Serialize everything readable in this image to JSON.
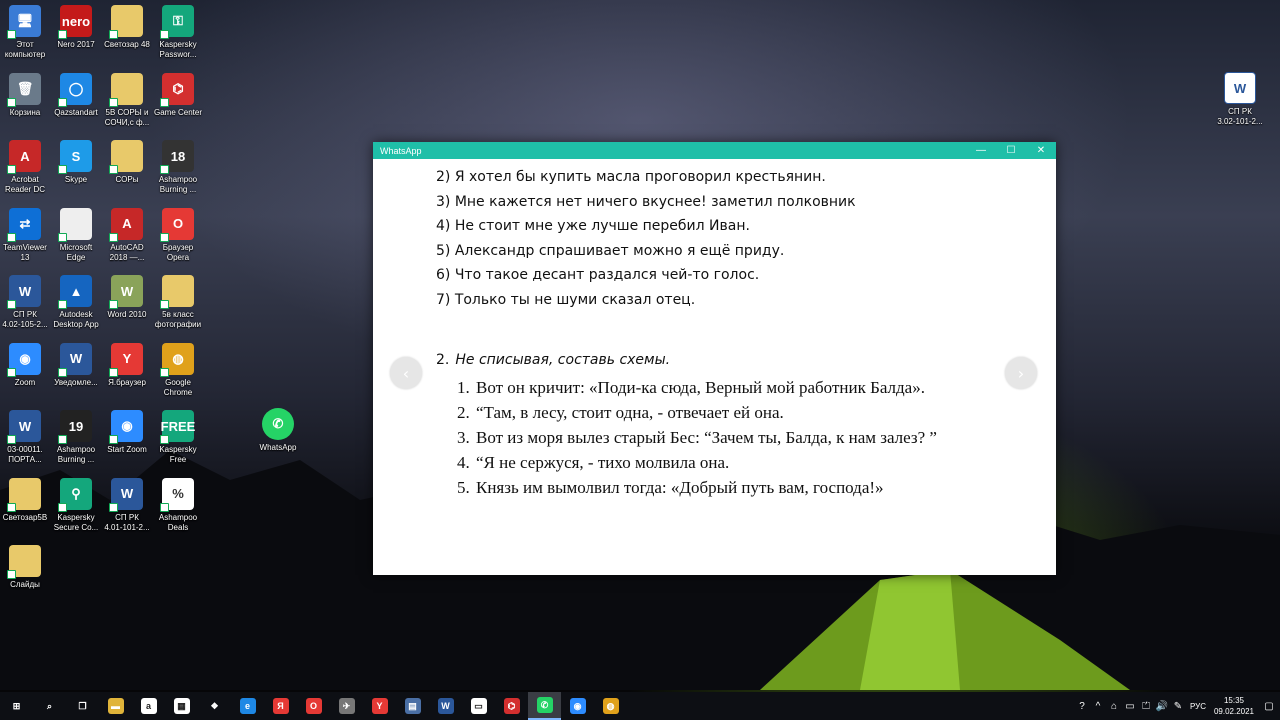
{
  "desktop": {
    "icons": [
      {
        "label": "Этот\nкомпьютер",
        "glyph": "🖥",
        "color": "#3a7bd5"
      },
      {
        "label": "Nero 2017",
        "glyph": "nero",
        "color": "#c41a1a"
      },
      {
        "label": "Светозар 48",
        "glyph": "",
        "color": "#e8c96a"
      },
      {
        "label": "Kaspersky\nPasswor...",
        "glyph": "⚿",
        "color": "#14a77c"
      },
      {
        "label": "Корзина",
        "glyph": "🗑",
        "color": "#6a7a8a"
      },
      {
        "label": "Qazstandart",
        "glyph": "◯",
        "color": "#1e88e5"
      },
      {
        "label": "5В СОРЫ и\nСОЧИ,с ф...",
        "glyph": "",
        "color": "#e8c96a"
      },
      {
        "label": "Game Center",
        "glyph": "⌬",
        "color": "#d32f2f"
      },
      {
        "label": "Acrobat\nReader DC",
        "glyph": "A",
        "color": "#c62828"
      },
      {
        "label": "Skype",
        "glyph": "S",
        "color": "#1e9be8"
      },
      {
        "label": "СОРы",
        "glyph": "",
        "color": "#e8c96a"
      },
      {
        "label": "Ashampoo\nBurning ...",
        "glyph": "18",
        "color": "#333"
      },
      {
        "label": "TeamViewer\n13",
        "glyph": "⇄",
        "color": "#0e6fd6"
      },
      {
        "label": "Microsoft\nEdge",
        "glyph": "",
        "color": "#eeeeee"
      },
      {
        "label": "AutoCAD\n2018 —...",
        "glyph": "A",
        "color": "#c62828"
      },
      {
        "label": "Браузер\nOpera",
        "glyph": "O",
        "color": "#e53935"
      },
      {
        "label": "СП РК\n4.02-105-2...",
        "glyph": "W",
        "color": "#2b579a"
      },
      {
        "label": "Autodesk\nDesktop App",
        "glyph": "▲",
        "color": "#1565c0"
      },
      {
        "label": "Word 2010",
        "glyph": "W",
        "color": "#8aa35a"
      },
      {
        "label": "5в класс\nфотографии",
        "glyph": "",
        "color": "#e8c96a"
      },
      {
        "label": "Zoom",
        "glyph": "◉",
        "color": "#2d8cff"
      },
      {
        "label": "Уведомле...",
        "glyph": "W",
        "color": "#2b579a"
      },
      {
        "label": "Я.браузер",
        "glyph": "Y",
        "color": "#e53935"
      },
      {
        "label": "Google\nChrome",
        "glyph": "◍",
        "color": "#e0a11b"
      },
      {
        "label": "03-00011.\nПОРТА...",
        "glyph": "W",
        "color": "#2b579a"
      },
      {
        "label": "Ashampoo\nBurning ...",
        "glyph": "19",
        "color": "#222"
      },
      {
        "label": "Start Zoom",
        "glyph": "◉",
        "color": "#2d8cff"
      },
      {
        "label": "Kaspersky\nFree",
        "glyph": "FREE",
        "color": "#14a77c"
      },
      {
        "label": "Светозар5В",
        "glyph": "",
        "color": "#e8c96a"
      },
      {
        "label": "Kaspersky\nSecure Co...",
        "glyph": "⚲",
        "color": "#14a77c"
      },
      {
        "label": "СП РК\n4.01-101-2...",
        "glyph": "W",
        "color": "#2b579a"
      },
      {
        "label": "Ashampoo\nDeals",
        "glyph": "%",
        "color": "#ffffff"
      },
      {
        "label": "Слайды",
        "glyph": "",
        "color": "#e8c96a"
      }
    ],
    "whatsapp_icon": {
      "label": "WhatsApp",
      "glyph": "✆",
      "color": "#25d366"
    },
    "right_icon": {
      "label": "СП РК\n3.02-101-2...",
      "glyph": "W",
      "color": "#2b579a"
    }
  },
  "window": {
    "title": "WhatsApp",
    "controls": {
      "minimize": "—",
      "maximize": "☐",
      "close": "✕"
    },
    "lines1": [
      "2) Я хотел бы купить масла проговорил крестьянин.",
      "3) Мне кажется нет ничего вкуснее! заметил полковник",
      "4) Не стоит мне уже лучше перебил Иван.",
      "5) Александр спрашивает можно я ещё приду.",
      "6) Что такое десант раздался чей-то голос.",
      "7) Только ты не шуми сказал отец."
    ],
    "task2": {
      "number": "2.",
      "text": "Не списывая, составь схемы."
    },
    "lines2": [
      {
        "n": "1.",
        "text": "Вот он кричит: «Поди-ка сюда, Верный мой работник Балда»."
      },
      {
        "n": "2.",
        "text": "“Там, в лесу, стоит одна, - отвечает ей она."
      },
      {
        "n": "3.",
        "text": "Вот из моря вылез старый Бес: “Зачем ты, Балда, к нам залез? ”"
      },
      {
        "n": "4.",
        "text": "“Я не сержуся, - тихо молвила она."
      },
      {
        "n": "5.",
        "text": "Князь им вымолвил тогда: «Добрый путь вам, господа!»"
      }
    ],
    "nav": {
      "prev": "‹",
      "next": "›"
    }
  },
  "taskbar": {
    "items": [
      {
        "name": "start",
        "glyph": "⊞",
        "color": "transparent"
      },
      {
        "name": "search",
        "glyph": "⌕",
        "color": "transparent"
      },
      {
        "name": "task-view",
        "glyph": "❐",
        "color": "transparent"
      },
      {
        "name": "explorer",
        "glyph": "▬",
        "color": "#e0b43a"
      },
      {
        "name": "amazon",
        "glyph": "a",
        "color": "#ffffff"
      },
      {
        "name": "store",
        "glyph": "▦",
        "color": "#ffffff"
      },
      {
        "name": "dropbox",
        "glyph": "❖",
        "color": "transparent"
      },
      {
        "name": "edge",
        "glyph": "e",
        "color": "#1e88e5"
      },
      {
        "name": "yandex-disk",
        "glyph": "Я",
        "color": "#e53935"
      },
      {
        "name": "opera",
        "glyph": "O",
        "color": "#e53935"
      },
      {
        "name": "network-app",
        "glyph": "✈",
        "color": "#777"
      },
      {
        "name": "yandex-browser",
        "glyph": "Y",
        "color": "#e53935"
      },
      {
        "name": "calculator",
        "glyph": "▤",
        "color": "#4a6fa5"
      },
      {
        "name": "word",
        "glyph": "W",
        "color": "#2b579a"
      },
      {
        "name": "notepad",
        "glyph": "▭",
        "color": "#ffffff"
      },
      {
        "name": "game-center",
        "glyph": "⌬",
        "color": "#d32f2f"
      },
      {
        "name": "whatsapp",
        "glyph": "✆",
        "color": "#25d366"
      },
      {
        "name": "zoom",
        "glyph": "◉",
        "color": "#2d8cff"
      },
      {
        "name": "chrome",
        "glyph": "◍",
        "color": "#e0a11b"
      }
    ],
    "tray": {
      "icons": [
        "?",
        "^",
        "⌂",
        "▭",
        "⏍",
        "🔊",
        "✎"
      ],
      "lang": "РУС",
      "time": "15:35",
      "date": "09.02.2021",
      "notifications": "▢"
    }
  }
}
